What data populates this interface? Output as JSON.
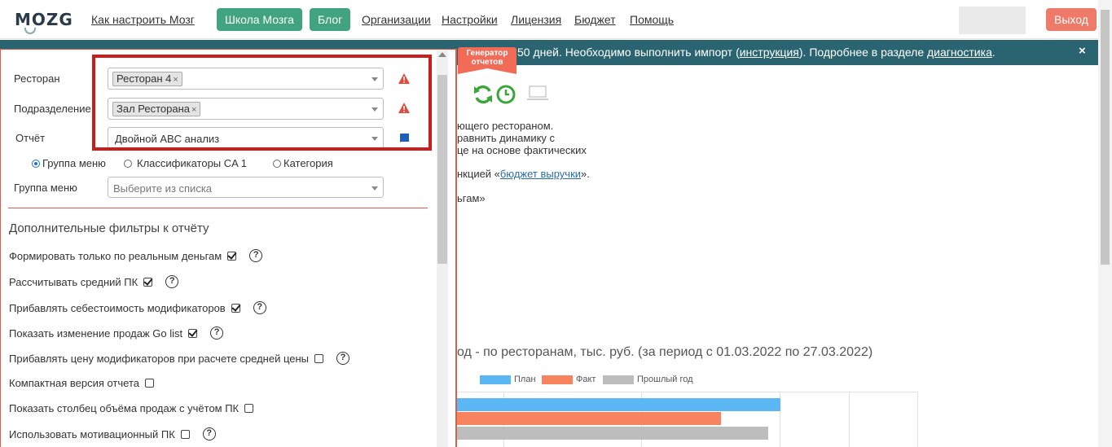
{
  "nav": {
    "logo": "MOZG",
    "links": [
      "Как настроить Мозг",
      "Организации",
      "Настройки",
      "Лицензия",
      "Бюджет",
      "Помощь"
    ],
    "school_btn": "Школа Мозга",
    "blog_btn": "Блог",
    "logout_btn": "Выход"
  },
  "banner": {
    "text_before": "50 дней. Необходимо выполнить импорт (",
    "link1": "инструкция",
    "text_mid": "). Подробнее в разделе ",
    "link2": "диагностика",
    "text_end": ".",
    "close": "×"
  },
  "generator": {
    "line1": "Генератор",
    "line2": "отчетов"
  },
  "background": {
    "line1": "ющего рестораном.",
    "line2": "равнить динамику с",
    "line3": "це на основе фактических",
    "line4_pre": "нкцией «",
    "line4_link": "бюджет выручки",
    "line4_post": "».",
    "line5": "ьгам»"
  },
  "chart_data": {
    "type": "bar",
    "title": "од - по ресторанам, тыс. руб. (за период с 01.03.2022 по 27.03.2022)",
    "legend_placement": "top",
    "series": [
      {
        "name": "План",
        "color": "#5bb8f5",
        "values": [
          397
        ]
      },
      {
        "name": "Факт",
        "color": "#f7845e",
        "values": [
          324
        ]
      },
      {
        "name": "Прошлый год",
        "color": "#bdbdbd",
        "values": [
          382
        ]
      }
    ],
    "grid": true
  },
  "form": {
    "restaurant_label": "Ресторан",
    "restaurant_tag": "Ресторан 4",
    "division_label": "Подразделение",
    "division_tag": "Зал Ресторана",
    "report_label": "Отчёт",
    "report_value": "Двойной ABC анализ",
    "radio": [
      "Группа меню",
      "Классификаторы CA 1",
      "Категория"
    ],
    "menu_group_label": "Группа меню",
    "menu_group_placeholder": "Выберите из списка",
    "tag_remove": "×"
  },
  "filters": {
    "title": "Дополнительные фильтры к отчёту",
    "items": [
      {
        "label": "Формировать только по реальным деньгам",
        "checked": true,
        "help": true
      },
      {
        "label": "Рассчитывать средний ПК",
        "checked": true,
        "help": true
      },
      {
        "label": "Прибавлять себестоимость модификаторов",
        "checked": true,
        "help": true
      },
      {
        "label": "Показать изменение продаж Go list",
        "checked": true,
        "help": true
      },
      {
        "label": "Прибавлять цену модификаторов при расчете средней цены",
        "checked": false,
        "help": true
      },
      {
        "label": "Компактная версия отчета",
        "checked": false,
        "help": false
      },
      {
        "label": "Показать столбец объёма продаж с учётом ПК",
        "checked": false,
        "help": false
      },
      {
        "label": "Использовать мотивационный ПК",
        "checked": false,
        "help": true
      }
    ],
    "help_glyph": "?"
  },
  "colors": {
    "accent_green": "#41a47e",
    "logout": "#f07a6a",
    "banner": "#2a6470",
    "highlight": "#cc1d1d"
  }
}
